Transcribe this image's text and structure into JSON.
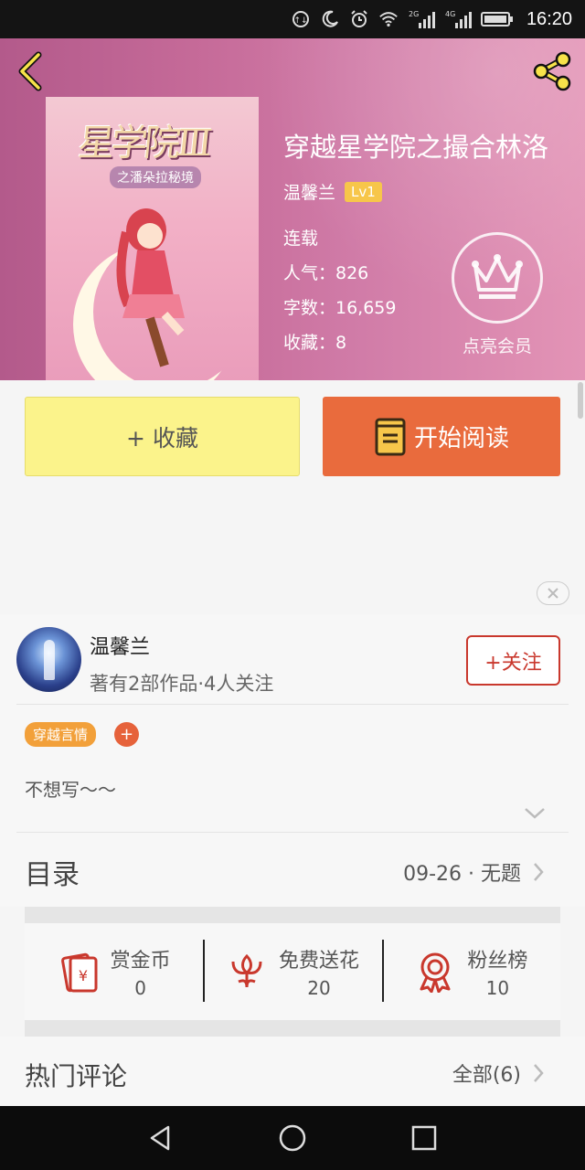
{
  "status_bar": {
    "time": "16:20",
    "icons": [
      "data-saver-icon",
      "moon-icon",
      "alarm-icon",
      "wifi-icon",
      "signal-2g-icon",
      "signal-4g-icon",
      "battery-icon"
    ],
    "network_2g": "2G",
    "network_4g": "4G"
  },
  "header": {
    "back_icon": "chevron-left-icon",
    "share_icon": "share-icon",
    "cover_art_title": "星学院Ⅲ",
    "cover_art_subtitle": "之潘朵拉秘境"
  },
  "book": {
    "title": "穿越星学院之撮合林洛",
    "author": "温馨兰",
    "level": "Lv1",
    "status": "连载",
    "popularity": "人气：826",
    "word_count": "字数：16,659",
    "favorites": "收藏：8"
  },
  "vip": {
    "icon": "crown-icon",
    "label": "点亮会员"
  },
  "actions": {
    "collect_label": "+ 收藏",
    "read_label": "开始阅读"
  },
  "author_card": {
    "name": "温馨兰",
    "subtitle": "著有2部作品·4人关注",
    "follow_label": "+关注",
    "tag": "穿越言情",
    "tag_add": "+",
    "intro": "不想写～～"
  },
  "catalog": {
    "label": "目录",
    "latest": "09-26 · 无题"
  },
  "stats": [
    {
      "label": "赏金币",
      "value": "0",
      "icon": "red-envelope-icon"
    },
    {
      "label": "免费送花",
      "value": "20",
      "icon": "flower-icon"
    },
    {
      "label": "粉丝榜",
      "value": "10",
      "icon": "medal-icon"
    }
  ],
  "comments": {
    "label": "热门评论",
    "all": "全部(6)"
  },
  "colors": {
    "accent_orange": "#e96b3d",
    "collect_yellow": "#fbf38b",
    "follow_red": "#c9382d",
    "level_badge": "#f7c64a",
    "tag_orange": "#f2a03a"
  }
}
